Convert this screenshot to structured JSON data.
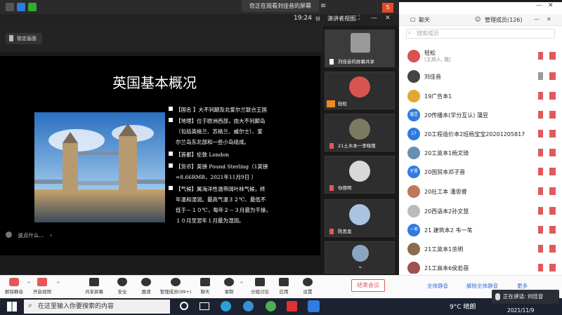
{
  "banner": "您正在观看刘佳音的屏幕",
  "toolbar": {
    "clock": "19:24",
    "view_mode": "演讲者视图"
  },
  "stage": {
    "lock_label": "锁定画面",
    "chat_placeholder": "说点什么...",
    "slide_title": "英国基本概况",
    "bullets": [
      [
        "【国名 】大不列颠及北爱尔兰联合王国"
      ],
      [
        "【地理】位于欧洲西部，由大不列颠岛",
        "（包括英格兰、苏格兰、威尔士）、爱",
        "尔兰岛东北部和一些小岛组成。"
      ],
      [
        "【首都】伦敦 London"
      ],
      [
        "【货币】英镑 Pound Sterling（1英镑",
        "=8.66RMB，2021年11月9日 ）"
      ],
      [
        "【气候】属海洋性温带阔叶林气候，终",
        "年温和湿润。最高气温３２℃、最低不",
        "低于－１０℃，每年２－３月最为干燥，",
        "１０月至翌年１月最为湿润。"
      ]
    ]
  },
  "thumbnails": [
    {
      "label": "刘佳音的屏幕共享"
    },
    {
      "label": "轻松"
    },
    {
      "label": "21土木本一李晓南"
    },
    {
      "label": "你德明"
    },
    {
      "label": "陈思恩"
    },
    {
      "label": ""
    }
  ],
  "panel": {
    "tab_chat": "聊天",
    "tab_members": "管理成员(126)",
    "search_placeholder": "搜索成员",
    "members": [
      {
        "name": "轻松",
        "sub": "(主持人, 我)",
        "color": "#d9534f",
        "avatar_text": ""
      },
      {
        "name": "刘佳音",
        "sub": "",
        "color": "#444444",
        "avatar_text": ""
      },
      {
        "name": "19广告本1",
        "sub": "",
        "color": "#e0a82e",
        "avatar_text": ""
      },
      {
        "name": "20传播本(学分互认) 蒲昱",
        "sub": "",
        "color": "#2f7be0",
        "avatar_text": "蒲昱"
      },
      {
        "name": "20工程造价本2班杨宝宝20201205817",
        "sub": "",
        "color": "#2f7be0",
        "avatar_text": "17"
      },
      {
        "name": "20工英本1杨文琦",
        "sub": "",
        "color": "#6a8fb5",
        "avatar_text": ""
      },
      {
        "name": "20国贸本邓子晋",
        "sub": "",
        "color": "#2f7be0",
        "avatar_text": "子晋"
      },
      {
        "name": "20社工本 潘思睿",
        "sub": "",
        "color": "#c0785a",
        "avatar_text": ""
      },
      {
        "name": "20西语本2孙文慧",
        "sub": "",
        "color": "#bbbbbb",
        "avatar_text": ""
      },
      {
        "name": "21 建筑本2 韦一苇",
        "sub": "",
        "color": "#2f7be0",
        "avatar_text": "一苇"
      },
      {
        "name": "21工英本1余明",
        "sub": "",
        "color": "#8a6d4e",
        "avatar_text": ""
      },
      {
        "name": "21工商本6侯若蓓",
        "sub": "",
        "color": "#a05050",
        "avatar_text": ""
      }
    ],
    "mute_all": "全体静音",
    "unmute_all": "解除全体静音",
    "more": "更多"
  },
  "bottom": {
    "buttons": [
      {
        "label": "解除静音"
      },
      {
        "label": "开启视频"
      },
      {
        "label": "共享屏幕"
      },
      {
        "label": "安全"
      },
      {
        "label": "邀请"
      },
      {
        "label": "管理成员(99+)"
      },
      {
        "label": "聊天"
      },
      {
        "label": "录制"
      },
      {
        "label": "分组讨论"
      },
      {
        "label": "应用"
      },
      {
        "label": "设置"
      }
    ],
    "end_meeting": "结束会议"
  },
  "taskbar": {
    "search_placeholder": "在这里输入你要搜索的内容",
    "weather": "9°C 晴朗",
    "date": "2021/11/9",
    "speaking": "正在讲话: 刘佳音"
  },
  "colors": {
    "accent": "#2f7be0",
    "danger": "#e05a5a"
  }
}
